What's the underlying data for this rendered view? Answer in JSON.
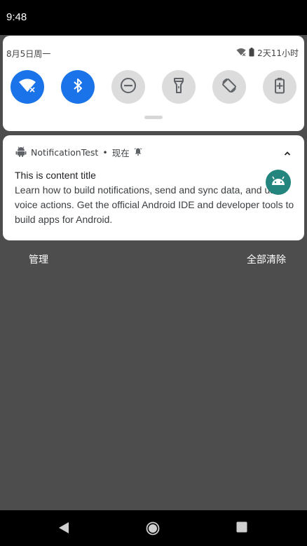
{
  "status_bar": {
    "time": "9:48"
  },
  "quick_settings": {
    "date": "8月5日周一",
    "battery_text": "2天11小时",
    "tiles": [
      {
        "name": "wifi",
        "state": "on"
      },
      {
        "name": "bluetooth",
        "state": "on"
      },
      {
        "name": "do-not-disturb",
        "state": "off"
      },
      {
        "name": "flashlight",
        "state": "off"
      },
      {
        "name": "auto-rotate",
        "state": "off"
      },
      {
        "name": "battery-saver",
        "state": "off"
      }
    ],
    "accent_color": "#1a73e8"
  },
  "notification": {
    "app_name": "NotificationTest",
    "separator": "•",
    "time": "现在",
    "title": "This is content title",
    "body": "Learn how to build notifications, send and sync data, and use voice actions. Get the official Android IDE and developer tools to build apps for Android.",
    "icon": "android-icon",
    "large_icon_color": "#23857d"
  },
  "footer": {
    "manage_label": "管理",
    "clear_all_label": "全部清除"
  },
  "nav": {
    "buttons": [
      "back-icon",
      "home-icon",
      "recents-icon"
    ]
  }
}
